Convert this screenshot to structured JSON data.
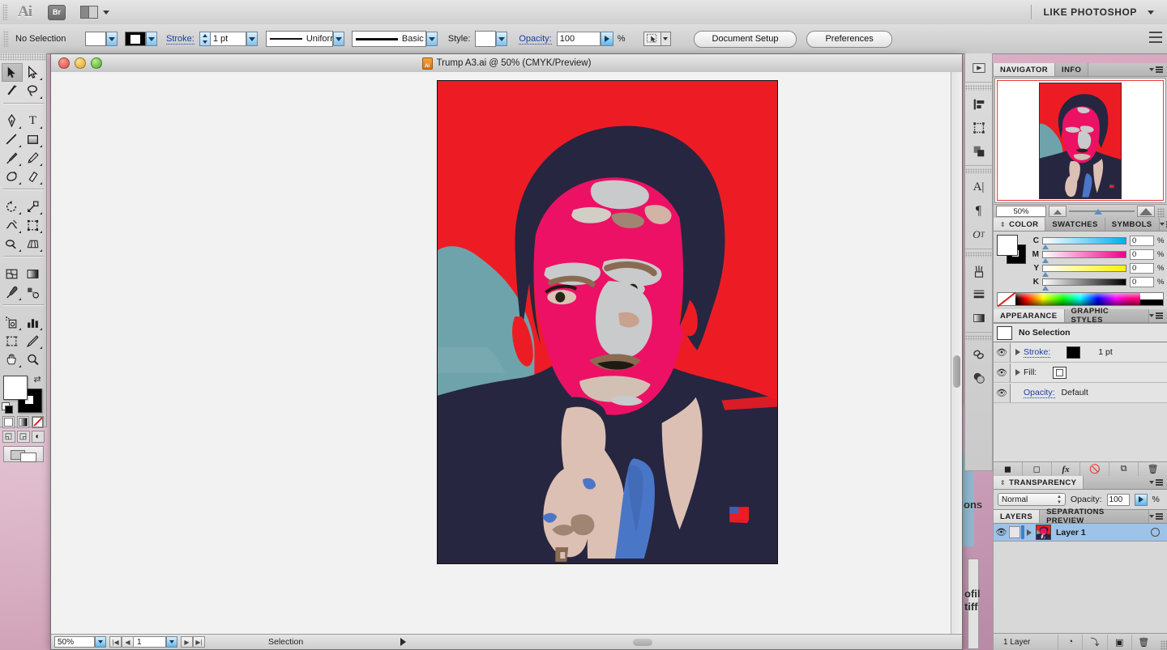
{
  "app": {
    "logo": "Ai",
    "bridge_badge": "Br",
    "workspace": "LIKE PHOTOSHOP"
  },
  "control_bar": {
    "selection_status": "No Selection",
    "stroke_label": "Stroke:",
    "stroke_weight": "1 pt",
    "variable_width_profile": "Uniform",
    "brush_definition": "Basic",
    "style_label": "Style:",
    "opacity_label": "Opacity:",
    "opacity_value": "100",
    "percent": "%",
    "document_setup_button": "Document Setup",
    "preferences_button": "Preferences"
  },
  "document": {
    "title": "Trump A3.ai @ 50% (CMYK/Preview)",
    "file_name": "Trump A3.ai",
    "zoom": "50%",
    "color_mode": "CMYK/Preview"
  },
  "status_bar": {
    "zoom_value": "50%",
    "page_number": "1",
    "tool_status": "Selection"
  },
  "navigator": {
    "tabs": [
      "NAVIGATOR",
      "INFO"
    ],
    "active_tab": "NAVIGATOR",
    "zoom_value": "50%"
  },
  "color_panel": {
    "tabs": [
      "COLOR",
      "SWATCHES",
      "SYMBOLS"
    ],
    "active_tab": "COLOR",
    "channels": [
      {
        "label": "C",
        "value": "0",
        "unit": "%"
      },
      {
        "label": "M",
        "value": "0",
        "unit": "%"
      },
      {
        "label": "Y",
        "value": "0",
        "unit": "%"
      },
      {
        "label": "K",
        "value": "0",
        "unit": "%"
      }
    ]
  },
  "appearance_panel": {
    "tabs": [
      "APPEARANCE",
      "GRAPHIC STYLES"
    ],
    "active_tab": "APPEARANCE",
    "header": "No Selection",
    "rows": [
      {
        "label": "Stroke:",
        "value": "1 pt"
      },
      {
        "label": "Fill:",
        "value": ""
      },
      {
        "label": "Opacity:",
        "value": "Default"
      }
    ]
  },
  "transparency_panel": {
    "title": "TRANSPARENCY",
    "blend_mode": "Normal",
    "opacity_label": "Opacity:",
    "opacity_value": "100",
    "percent": "%"
  },
  "layers_panel": {
    "tabs": [
      "LAYERS",
      "SEPARATIONS PREVIEW"
    ],
    "active_tab": "LAYERS",
    "layers": [
      {
        "name": "Layer 1"
      }
    ],
    "footer_count": "1 Layer"
  },
  "toolbox": {
    "tools": [
      "selection-tool",
      "direct-selection-tool",
      "magic-wand-tool",
      "lasso-tool",
      "pen-tool",
      "type-tool",
      "line-segment-tool",
      "rectangle-tool",
      "paintbrush-tool",
      "pencil-tool",
      "blob-brush-tool",
      "eraser-tool",
      "rotate-tool",
      "scale-tool",
      "width-tool",
      "free-transform-tool",
      "shape-builder-tool",
      "perspective-grid-tool",
      "mesh-tool",
      "gradient-tool",
      "eyedropper-tool",
      "blend-tool",
      "symbol-sprayer-tool",
      "column-graph-tool",
      "artboard-tool",
      "slice-tool",
      "hand-tool",
      "zoom-tool"
    ]
  },
  "dock_icons": [
    "navigator-icon",
    "align-icon",
    "transform-icon",
    "pathfinder-icon",
    "character-icon",
    "paragraph-icon",
    "opentype-icon",
    "brushes-icon",
    "stroke-icon",
    "gradient-icon",
    "links-icon",
    "transparency-icon"
  ],
  "colors": {
    "artboard_background": "#ed1c24",
    "hair_dark": "#262640",
    "face_magenta": "#ec1164",
    "highlight_gray": "#c9cacc",
    "skin_light": "#ddc0b4",
    "tan": "#a08573",
    "teal": "#6fa3ab",
    "tie_blue": "#4a76c8",
    "accent_blue": "#3f7fd0"
  },
  "artwork": {
    "title": "Donald Trump pop-art portrait vector",
    "description": "Posterized vector portrait on red background with teal sky wedge, navy suit and hair, magenta face, blue necktie and small US flag lapel pin"
  }
}
